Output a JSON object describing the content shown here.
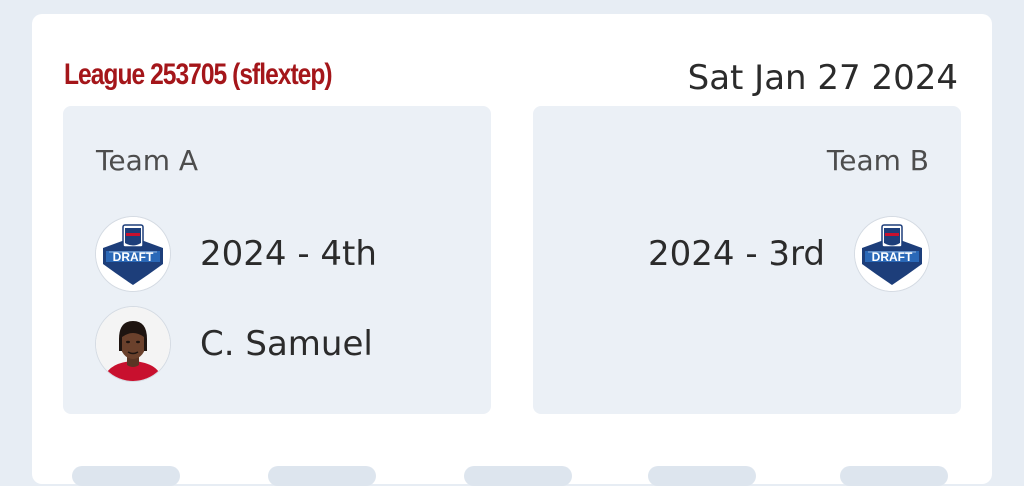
{
  "trade": {
    "league_title": "League 253705 (sflextep)",
    "date": "Sat Jan 27 2024"
  },
  "team_a": {
    "name": "Team A",
    "assets": [
      {
        "type": "draft-pick",
        "label": "2024 - 4th",
        "icon": "nfl-draft-logo-icon"
      },
      {
        "type": "player",
        "label": "C. Samuel",
        "icon": "player-headshot"
      }
    ]
  },
  "team_b": {
    "name": "Team B",
    "assets": [
      {
        "type": "draft-pick",
        "label": "2024 - 3rd",
        "icon": "nfl-draft-logo-icon"
      }
    ]
  },
  "colors": {
    "league_title": "#a4161a",
    "panel_bg": "#ebf0f6",
    "page_bg": "#e7edf4"
  }
}
